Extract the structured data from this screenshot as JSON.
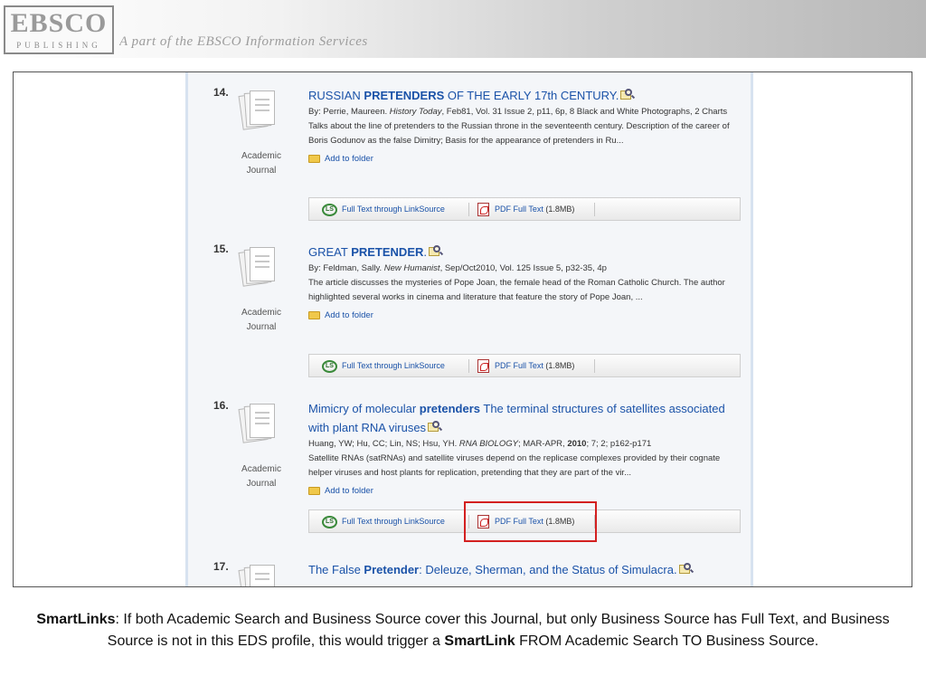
{
  "header": {
    "logo_top": "EBSCO",
    "logo_bottom": "PUBLISHING",
    "tagline": "A part of the EBSCO Information Services"
  },
  "results": [
    {
      "number": "14.",
      "type": [
        "Academic",
        "Journal"
      ],
      "title_parts": [
        "RUSSIAN ",
        "PRETENDERS",
        " OF THE EARLY 17th CENTURY."
      ],
      "byline_parts": [
        "By: Perrie, Maureen. ",
        "History Today",
        ", Feb81, Vol. 31 Issue 2, p11, 6p, 8 Black and White Photographs, 2 Charts"
      ],
      "description": "Talks about the line of pretenders to the Russian throne in the seventeenth century. Description of the career of Boris Godunov as the false Dimitry; Basis for the appearance of pretenders in Ru...",
      "folder_label": "Add to folder",
      "linksource_label": "Full Text through LinkSource",
      "pdf_label": "PDF Full Text",
      "pdf_size": "(1.8MB)"
    },
    {
      "number": "15.",
      "type": [
        "Academic",
        "Journal"
      ],
      "title_parts": [
        "GREAT ",
        "PRETENDER",
        "."
      ],
      "byline_parts": [
        "By: Feldman, Sally. ",
        "New Humanist",
        ", Sep/Oct2010, Vol. 125 Issue 5, p32-35, 4p"
      ],
      "description": "The article discusses the mysteries of Pope Joan, the female head of the Roman Catholic Church. The author highlighted several works in cinema and literature that feature the story of Pope Joan, ...",
      "folder_label": "Add to folder",
      "linksource_label": "Full Text through LinkSource",
      "pdf_label": "PDF Full Text",
      "pdf_size": "(1.8MB)"
    },
    {
      "number": "16.",
      "type": [
        "Academic",
        "Journal"
      ],
      "title_parts": [
        "Mimicry of molecular ",
        "pretenders",
        " The terminal structures of satellites associated with plant RNA viruses"
      ],
      "byline_parts": [
        "Huang, YW; Hu, CC; Lin, NS; Hsu, YH. ",
        "RNA BIOLOGY",
        "; MAR-APR, ",
        "2010",
        "; 7; 2; p162-p171"
      ],
      "description": "Satellite RNAs (satRNAs) and satellite viruses depend on the replicase complexes provided by their cognate helper viruses and host plants for replication, pretending that they are part of the vir...",
      "folder_label": "Add to folder",
      "linksource_label": "Full Text through LinkSource",
      "pdf_label": "PDF Full Text",
      "pdf_size": "(1.8MB)"
    },
    {
      "number": "17.",
      "title_parts": [
        "The False ",
        "Pretender",
        ": Deleuze, Sherman, and the Status of Simulacra."
      ]
    }
  ],
  "caption": {
    "term": "SmartLinks",
    "part1": ": If both Academic Search and Business Source cover this Journal, but only Business Source has Full Text, and Business Source is not in this EDS profile, this would trigger a ",
    "term2": "SmartLink",
    "part2": " FROM Academic Search TO Business Source."
  },
  "colors": {
    "link": "#1a52a8",
    "highlight": "#d32020",
    "panel_bg": "#f4f6f9"
  }
}
